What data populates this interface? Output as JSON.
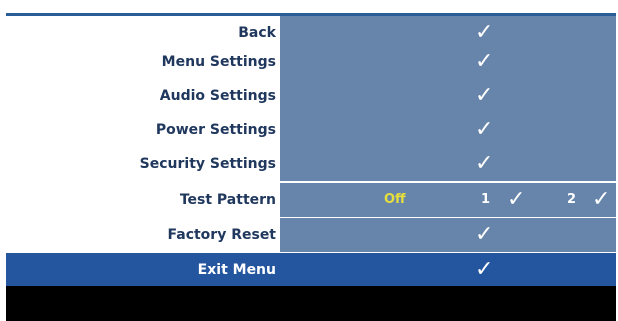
{
  "menu": {
    "items": [
      {
        "label": "Back",
        "value": "✓"
      },
      {
        "label": "Menu Settings",
        "value": "✓"
      },
      {
        "label": "Audio Settings",
        "value": "✓"
      },
      {
        "label": "Power Settings",
        "value": "✓"
      },
      {
        "label": "Security Settings",
        "value": "✓"
      },
      {
        "label": "Test Pattern",
        "options": [
          "Off",
          "1",
          "2"
        ],
        "selected_option": "Off",
        "check": "✓"
      },
      {
        "label": "Factory Reset",
        "value": "✓"
      },
      {
        "label": "Exit Menu",
        "value": "✓",
        "highlighted": true
      }
    ]
  },
  "colors": {
    "accent_line": "#2b5d96",
    "label_text": "#20385e",
    "value_bg": "#6784aa",
    "highlight_bg": "#2456a0",
    "option_active": "#e7df3a",
    "footer_bar": "#000000"
  }
}
